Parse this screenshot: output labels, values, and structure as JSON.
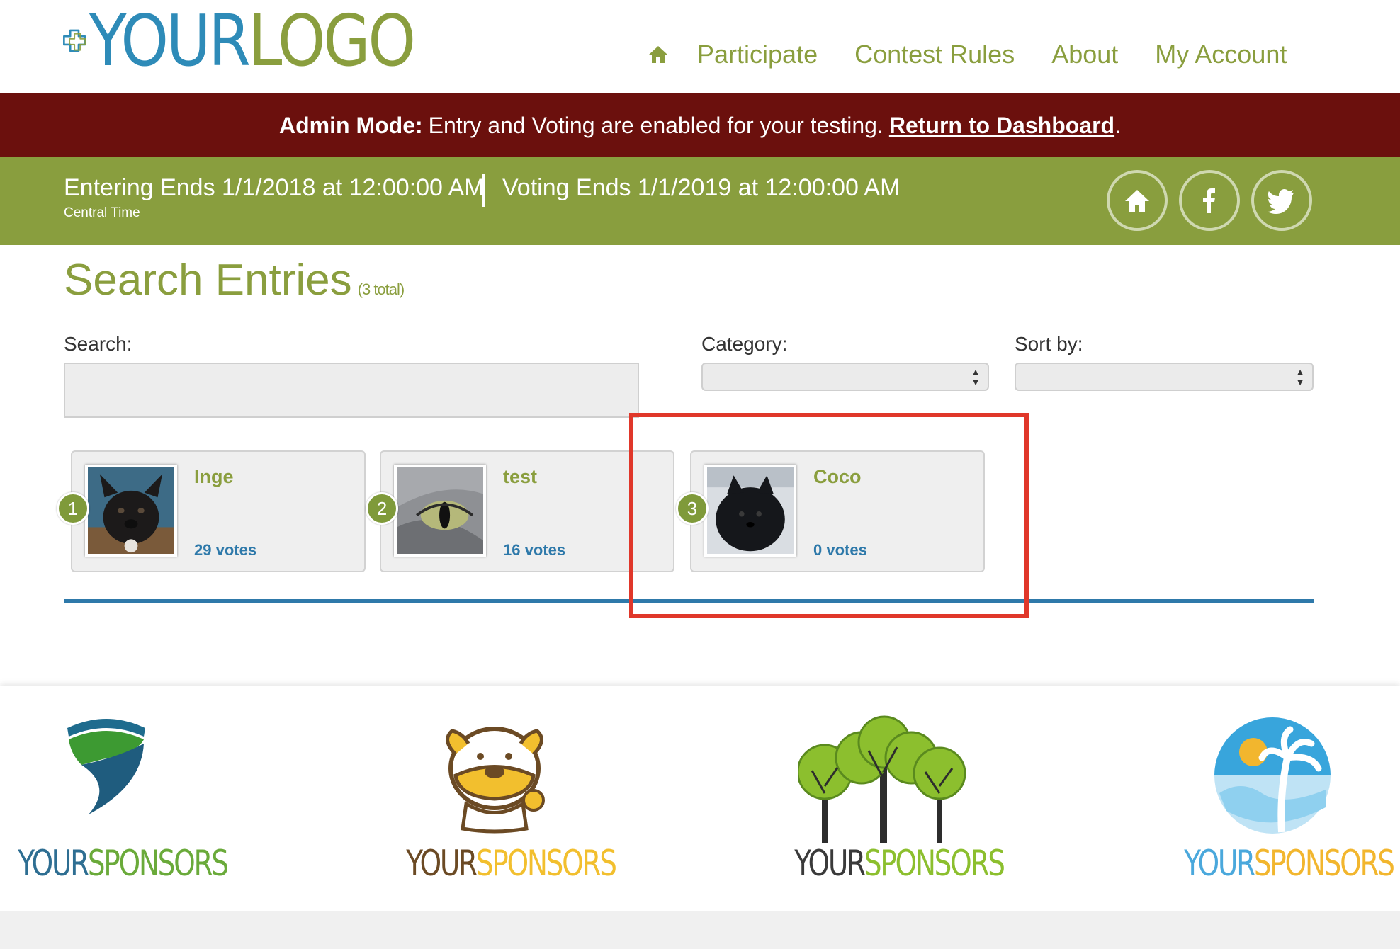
{
  "logo": {
    "part1": "YOUR",
    "part2": "LOGO"
  },
  "nav": {
    "items": [
      "Participate",
      "Contest Rules",
      "About",
      "My Account"
    ]
  },
  "admin_bar": {
    "label": "Admin Mode:",
    "message": "Entry and Voting are enabled for your testing.",
    "link": "Return to Dashboard",
    "suffix": "."
  },
  "dates": {
    "entering": "Entering Ends 1/1/2018 at 12:00:00 AM",
    "voting": "Voting Ends 1/1/2019 at 12:00:00 AM",
    "timezone": "Central Time"
  },
  "search": {
    "title": "Search Entries",
    "count": "(3 total)",
    "search_label": "Search:",
    "search_value": "",
    "category_label": "Category:",
    "category_value": "",
    "sort_label": "Sort by:",
    "sort_value": ""
  },
  "entries": [
    {
      "rank": "1",
      "name": "Inge",
      "votes": "29 votes"
    },
    {
      "rank": "2",
      "name": "test",
      "votes": "16 votes"
    },
    {
      "rank": "3",
      "name": "Coco",
      "votes": "0 votes"
    }
  ],
  "sponsors": [
    {
      "part1": "YOUR",
      "part2": "SPONSORS",
      "color1": "#2e6e92",
      "color2": "#6aaa3a"
    },
    {
      "part1": "YOUR",
      "part2": "SPONSORS",
      "color1": "#6b4a24",
      "color2": "#f2bf2e"
    },
    {
      "part1": "YOUR",
      "part2": "SPONSORS",
      "color1": "#3a3a3a",
      "color2": "#8cbf2e"
    },
    {
      "part1": "YOUR",
      "part2": "SPONSORS",
      "color1": "#4aa8dc",
      "color2": "#f2b62e"
    }
  ],
  "colors": {
    "brand_green": "#8a9e3e",
    "brand_blue": "#2e79aa",
    "admin_red": "#6b100d",
    "highlight": "#e0372a"
  }
}
